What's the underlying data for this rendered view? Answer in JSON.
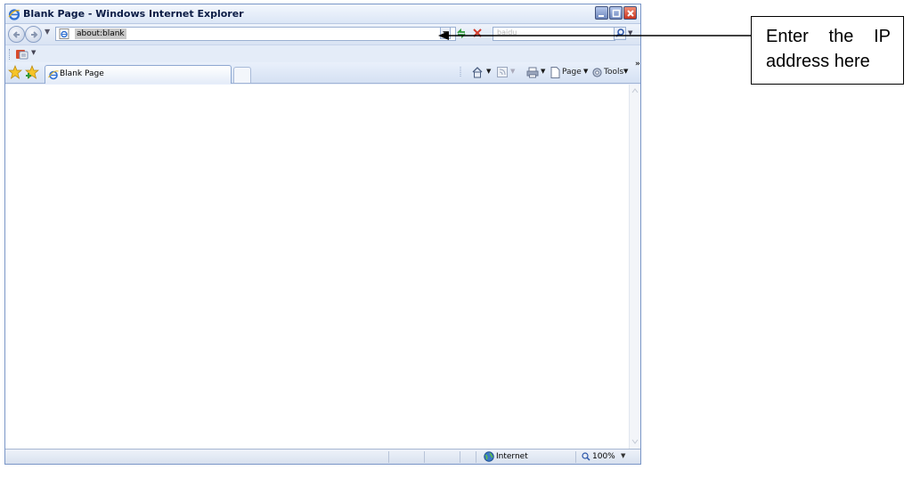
{
  "window": {
    "title": "Blank Page - Windows Internet Explorer"
  },
  "address_bar": {
    "url": "about:blank"
  },
  "search": {
    "placeholder": "baidu"
  },
  "tabs": [
    {
      "label": "Blank Page"
    }
  ],
  "command_bar": {
    "page_label": "Page",
    "tools_label": "Tools",
    "more_label": "»"
  },
  "status_bar": {
    "zone_label": "Internet",
    "zoom_label": "100%"
  },
  "annotation": {
    "text": "Enter the IP address here"
  },
  "colors": {
    "frame_blue": "#7a96c7",
    "close_red": "#c7341f",
    "annotation_text": "#000000"
  }
}
